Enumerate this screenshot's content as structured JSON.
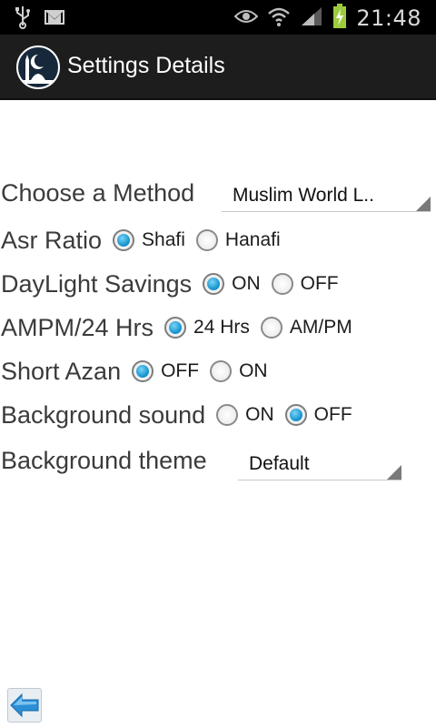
{
  "status_bar": {
    "time": "21:48",
    "icons": [
      "usb-icon",
      "gmail-icon",
      "eye-icon",
      "wifi-icon",
      "signal-icon",
      "battery-charging-icon"
    ]
  },
  "action_bar": {
    "title": "Settings Details",
    "logo_icon": "mosque-crescent-logo"
  },
  "settings": {
    "method": {
      "label": "Choose a Method",
      "value": "Muslim World L.."
    },
    "asr": {
      "label": "Asr Ratio",
      "options": [
        "Shafi",
        "Hanafi"
      ],
      "selected": "Shafi"
    },
    "daylight": {
      "label": "DayLight Savings",
      "options": [
        "ON",
        "OFF"
      ],
      "selected": "ON"
    },
    "ampm": {
      "label": "AMPM/24 Hrs",
      "options": [
        "24 Hrs",
        "AM/PM"
      ],
      "selected": "24 Hrs"
    },
    "azan": {
      "label": "Short Azan",
      "options": [
        "OFF",
        "ON"
      ],
      "selected": "OFF"
    },
    "bgsound": {
      "label": "Background sound",
      "options": [
        "ON",
        "OFF"
      ],
      "selected": "OFF"
    },
    "theme": {
      "label": "Background theme",
      "value": "Default"
    }
  },
  "footer": {
    "back_icon": "back-arrow-icon"
  },
  "colors": {
    "accent": "#0d8fcc",
    "actionbar": "#1d1d1d",
    "statusbar": "#000000",
    "text": "#3b3b3b"
  }
}
